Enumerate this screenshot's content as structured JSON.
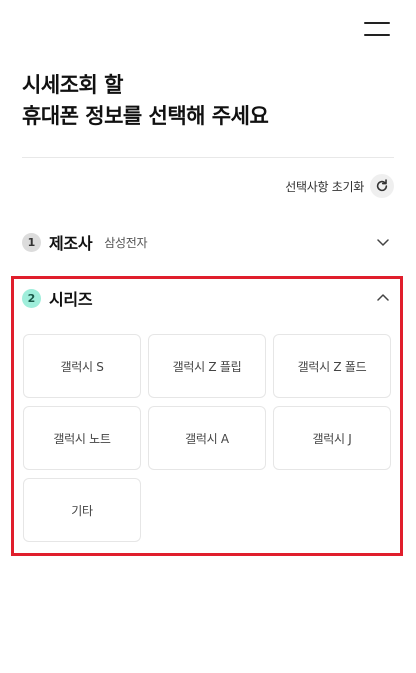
{
  "header": {
    "title_line1": "시세조회 할",
    "title_line2": "휴대폰 정보를 선택해 주세요"
  },
  "reset": {
    "label": "선택사항 초기화",
    "icon": "refresh-icon"
  },
  "steps": [
    {
      "number": "1",
      "title": "제조사",
      "value": "삼성전자",
      "expanded": false
    },
    {
      "number": "2",
      "title": "시리즈",
      "value": "",
      "expanded": true
    }
  ],
  "series_options": [
    "갤럭시 S",
    "갤럭시 Z 플립",
    "갤럭시 Z 폴드",
    "갤럭시 노트",
    "갤럭시 A",
    "갤럭시 J",
    "기타"
  ],
  "colors": {
    "active_step_badge": "#9feedb",
    "highlight_border": "#e01e2c"
  }
}
